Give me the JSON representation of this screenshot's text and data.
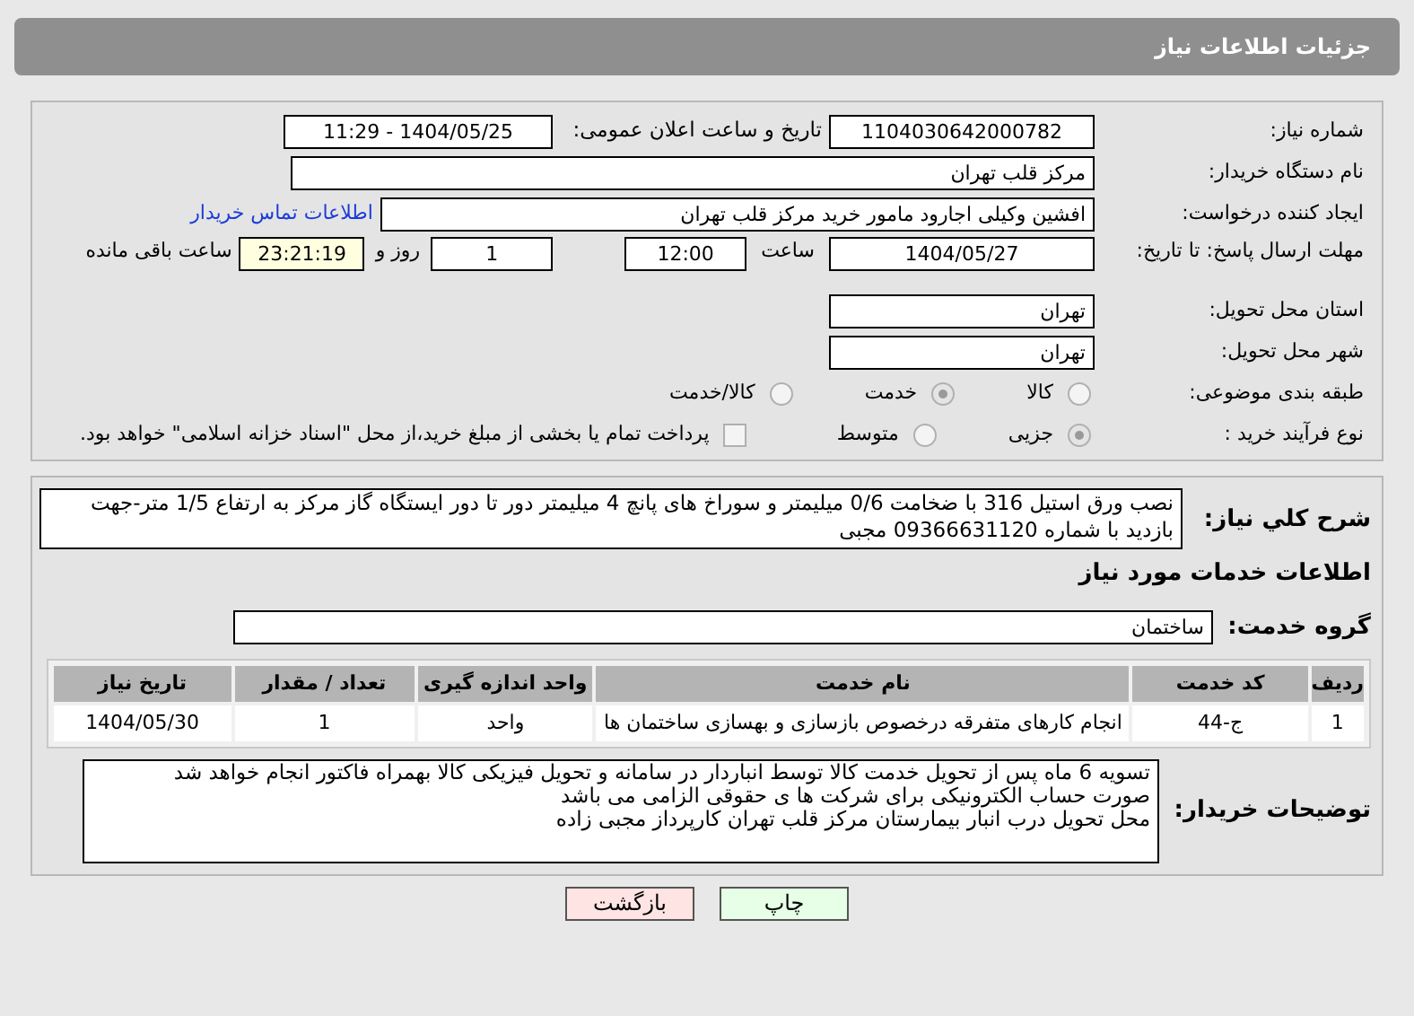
{
  "header": {
    "title": "جزئیات اطلاعات نیاز"
  },
  "need_number": {
    "label": "شماره نیاز:",
    "value": "1104030642000782"
  },
  "announce": {
    "label": "تاریخ و ساعت اعلان عمومی:",
    "value": "1404/05/25 - 11:29"
  },
  "buyer": {
    "label": "نام دستگاه خریدار:",
    "value": "مرکز قلب تهران"
  },
  "creator": {
    "label": "ایجاد کننده درخواست:",
    "value": "افشین وکیلی اجارود مامور خرید مرکز قلب تهران",
    "link": "اطلاعات تماس خریدار"
  },
  "deadline": {
    "label": "مهلت ارسال پاسخ: تا تاریخ:",
    "date": "1404/05/27",
    "time_label": "ساعت",
    "time": "12:00",
    "days": "1",
    "days_label": "روز و",
    "remaining": "23:21:19",
    "remaining_label": "ساعت باقی مانده"
  },
  "province": {
    "label": "استان محل تحویل:",
    "value": "تهران"
  },
  "city": {
    "label": "شهر محل تحویل:",
    "value": "تهران"
  },
  "category": {
    "label": "طبقه بندی موضوعی:",
    "options": [
      {
        "label": "کالا",
        "selected": false
      },
      {
        "label": "خدمت",
        "selected": true
      },
      {
        "label": "کالا/خدمت",
        "selected": false
      }
    ]
  },
  "process": {
    "label": "نوع فرآیند خرید :",
    "options": [
      {
        "label": "جزیی",
        "selected": true
      },
      {
        "label": "متوسط",
        "selected": false
      }
    ],
    "treasury": {
      "label": "پرداخت تمام یا بخشی از مبلغ خرید،از محل \"اسناد خزانه اسلامی\" خواهد بود.",
      "checked": false
    }
  },
  "description": {
    "label": "شرح کلي نیاز:",
    "value": "نصب ورق استیل 316 با ضخامت 0/6 میلیمتر و سوراخ های پانچ 4 میلیمتر دور تا دور ایستگاه گاز مرکز به ارتفاع 1/5 متر-جهت بازدید با شماره 09366631120 مجبی"
  },
  "services_heading": "اطلاعات خدمات مورد نیاز",
  "service_group": {
    "label": "گروه خدمت:",
    "value": "ساختمان"
  },
  "table": {
    "columns": [
      "ردیف",
      "کد خدمت",
      "نام خدمت",
      "واحد اندازه گیری",
      "تعداد / مقدار",
      "تاریخ نیاز"
    ],
    "rows": [
      [
        "1",
        "ج-44",
        "انجام کارهای متفرقه درخصوص بازسازی و بهسازی ساختمان ها",
        "واحد",
        "1",
        "1404/05/30"
      ]
    ]
  },
  "notes": {
    "label": "توضیحات خریدار:",
    "lines": [
      "تسویه 6 ماه پس از تحویل خدمت کالا توسط انباردار در سامانه و تحویل فیزیکی کالا بهمراه فاکتور انجام خواهد شد",
      "صورت حساب الکترونیکی برای شرکت ها ی حقوقی الزامی می باشد",
      "محل تحویل درب انبار بیمارستان مرکز قلب تهران کارپرداز مجبی زاده"
    ]
  },
  "buttons": [
    {
      "label": "چاپ",
      "kind": "print"
    },
    {
      "label": "بازگشت",
      "kind": "back"
    }
  ]
}
